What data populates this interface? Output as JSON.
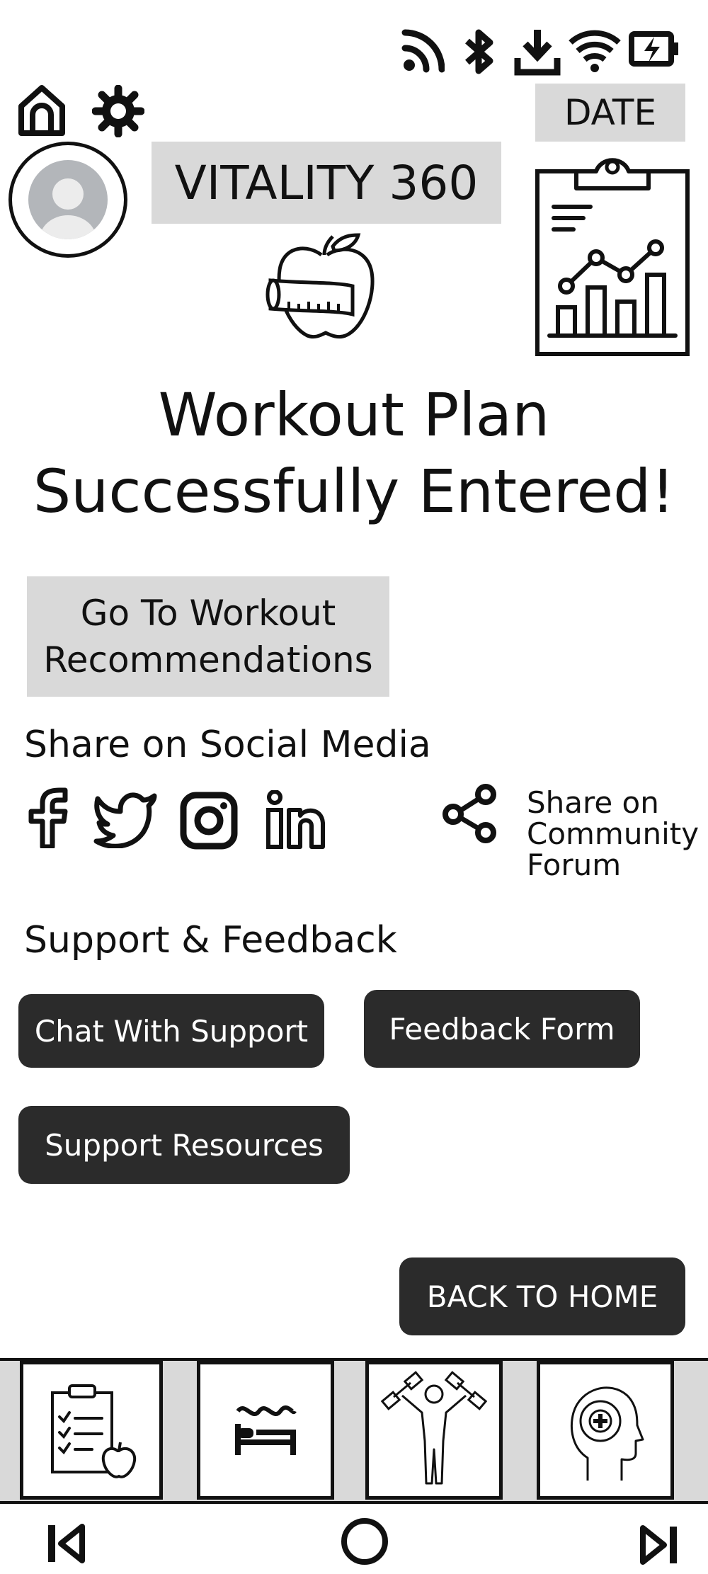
{
  "status_bar": {
    "icons": [
      "rss-feed-icon",
      "bluetooth-icon",
      "download-icon",
      "wifi-icon",
      "battery-charging-icon"
    ]
  },
  "header": {
    "home_icon": "home-icon",
    "settings_icon": "gear-icon",
    "date_label": "DATE",
    "app_title": "VITALITY 360",
    "avatar_icon": "user-avatar-icon",
    "logo_icon": "apple-measuring-tape-icon",
    "report_icon": "clipboard-chart-icon"
  },
  "main": {
    "heading_line1": "Workout Plan",
    "heading_line2": "Successfully Entered!",
    "recommendations_btn_line1": "Go To Workout",
    "recommendations_btn_line2": "Recommendations"
  },
  "social": {
    "title": "Share on Social Media",
    "icons": [
      "facebook-icon",
      "twitter-icon",
      "instagram-icon",
      "linkedin-icon"
    ],
    "community_line1": "Share on",
    "community_line2": "Community",
    "community_line3": "Forum"
  },
  "support": {
    "title": "Support & Feedback",
    "chat_label": "Chat With Support",
    "feedback_label": "Feedback Form",
    "resources_label": "Support Resources"
  },
  "back_home_label": "BACK TO HOME",
  "bottom_tabs": [
    {
      "icon": "meal-checklist-icon"
    },
    {
      "icon": "sleep-bed-icon"
    },
    {
      "icon": "fitness-dumbbell-icon"
    },
    {
      "icon": "mental-health-icon"
    }
  ],
  "nav_bar": {
    "icons": [
      "skip-previous-icon",
      "home-circle-icon",
      "skip-next-icon"
    ]
  }
}
